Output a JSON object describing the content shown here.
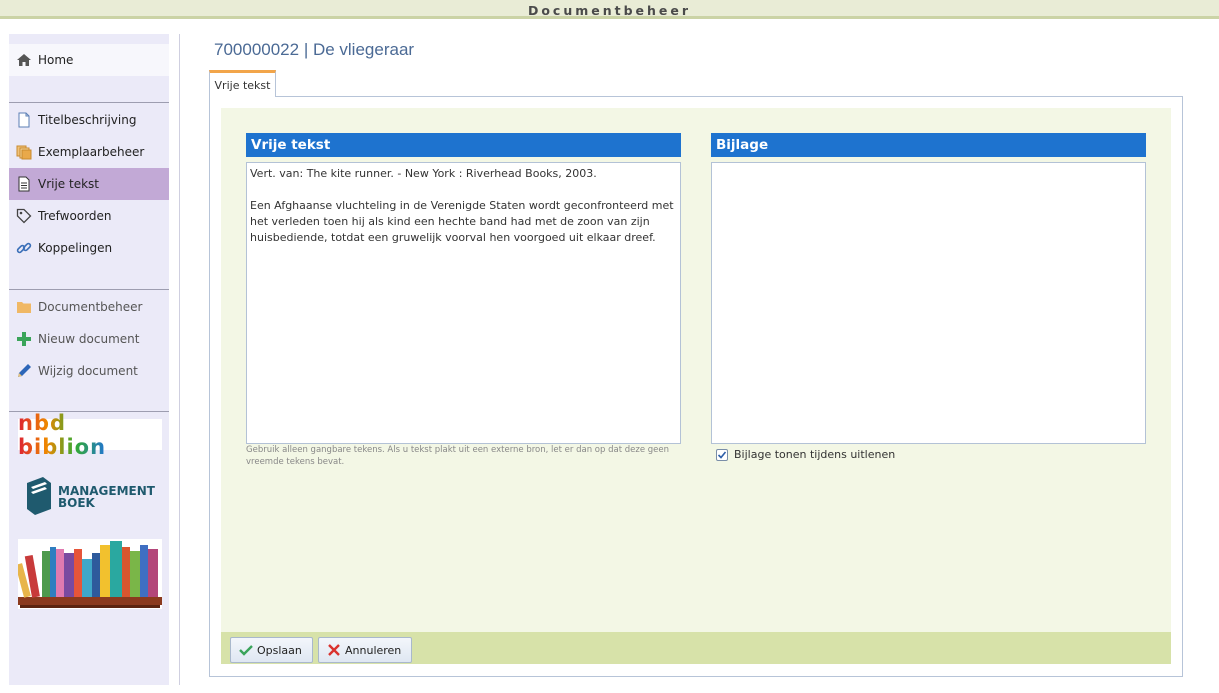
{
  "app": {
    "title": "Documentbeheer"
  },
  "sidebar": {
    "home": {
      "label": "Home",
      "icon": "home-icon"
    },
    "section1": [
      {
        "label": "Titelbeschrijving",
        "icon": "document-icon"
      },
      {
        "label": "Exemplaarbeheer",
        "icon": "copies-icon"
      },
      {
        "label": "Vrije tekst",
        "icon": "text-document-icon",
        "active": true
      },
      {
        "label": "Trefwoorden",
        "icon": "tag-icon"
      },
      {
        "label": "Koppelingen",
        "icon": "link-icon"
      }
    ],
    "section2": [
      {
        "label": "Documentbeheer",
        "icon": "folder-icon"
      },
      {
        "label": "Nieuw document",
        "icon": "plus-icon"
      },
      {
        "label": "Wijzig document",
        "icon": "pencil-icon"
      }
    ],
    "logos": {
      "nbd": "nbd biblion",
      "mb_line1": "MANAGEMENT",
      "mb_line2": "BOEK"
    }
  },
  "header": {
    "title": "700000022 | De vliegeraar"
  },
  "tabs": [
    {
      "label": "Vrije tekst",
      "active": true
    }
  ],
  "form": {
    "free_text": {
      "heading": "Vrije tekst",
      "value": "Vert. van: The kite runner. - New York : Riverhead Books, 2003.\n\nEen Afghaanse vluchteling in de Verenigde Staten wordt geconfronteerd met het verleden toen hij als kind een hechte band had met de zoon van zijn huisbediende, totdat een gruwelijk voorval hen voorgoed uit elkaar dreef.",
      "hint": "Gebruik alleen gangbare tekens. Als u tekst plakt uit een externe bron, let er dan op dat deze geen vreemde tekens bevat."
    },
    "attachment": {
      "heading": "Bijlage",
      "value": "",
      "checkbox_label": "Bijlage tonen tijdens uitlenen",
      "checked": true
    },
    "buttons": {
      "save": "Opslaan",
      "cancel": "Annuleren"
    }
  },
  "colors": {
    "accent_blue": "#1e73cf",
    "active_nav": "#c2a9d6",
    "panel_bg": "#f3f7e5",
    "footer_bg": "#d7e2a9",
    "tab_accent": "#f2a54a"
  }
}
